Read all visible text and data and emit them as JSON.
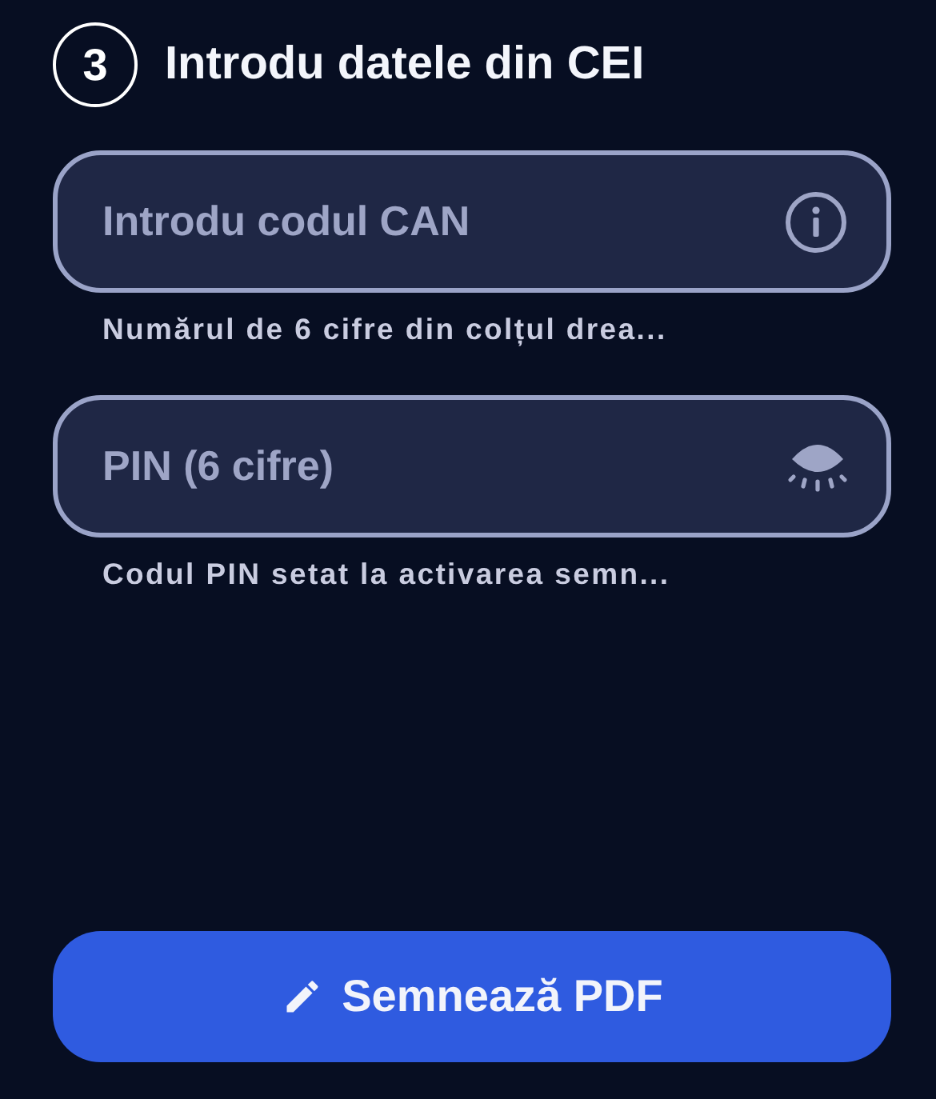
{
  "step": {
    "number": "3",
    "title": "Introdu datele din CEI"
  },
  "fields": [
    {
      "kind": "info",
      "placeholder": "Introdu codul CAN",
      "hint": "Numărul de 6 cifre din colțul drea..."
    },
    {
      "kind": "password",
      "placeholder": "PIN (6 cifre)",
      "hint": "Codul PIN setat la activarea semn..."
    }
  ],
  "submit": {
    "label": "Semnează PDF"
  }
}
